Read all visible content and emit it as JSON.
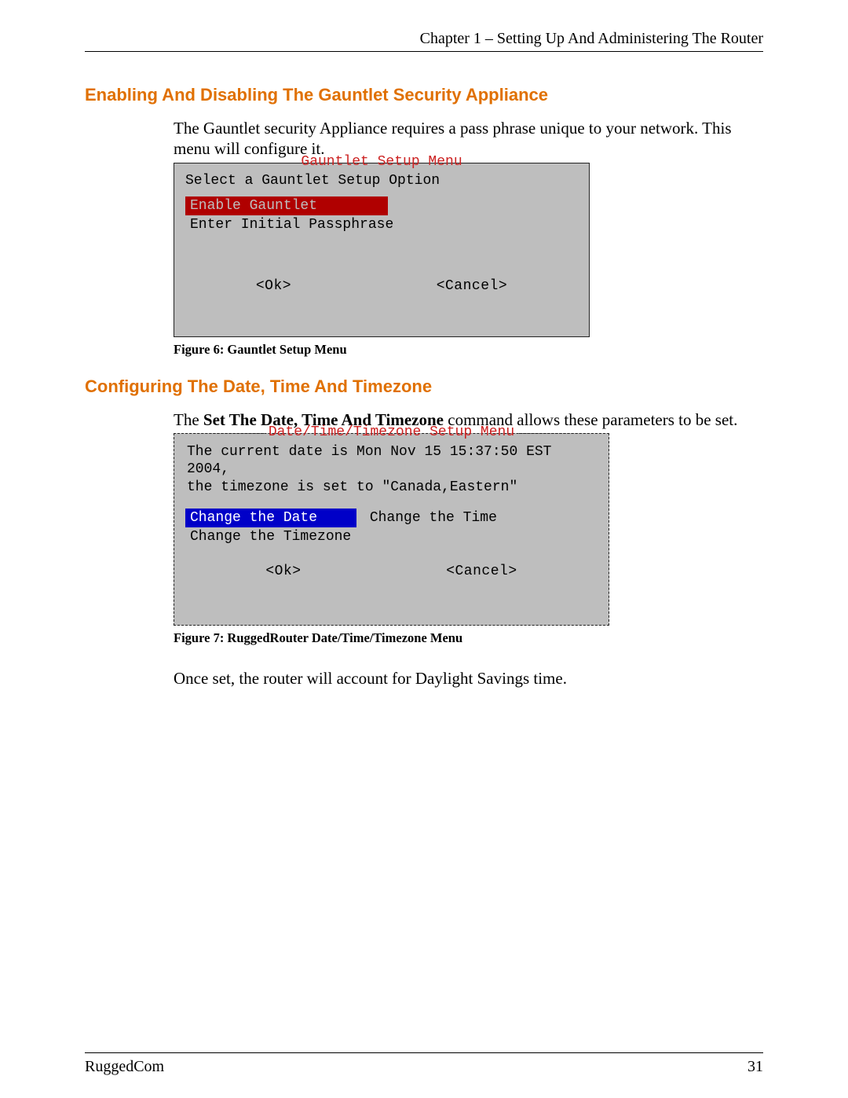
{
  "header": {
    "chapter": "Chapter 1 – Setting Up And Administering The Router"
  },
  "section1": {
    "heading": "Enabling And Disabling The Gauntlet Security Appliance",
    "para": "The Gauntlet security Appliance requires a pass phrase unique to your network.   This menu will configure it.",
    "term": {
      "title": "Gauntlet Setup Menu",
      "prompt": "Select a Gauntlet Setup Option",
      "options": [
        "Enable Gauntlet",
        "Enter Initial Passphrase"
      ],
      "ok": "<Ok>",
      "cancel": "<Cancel>"
    },
    "caption": "Figure 6: Gauntlet Setup Menu"
  },
  "section2": {
    "heading": "Configuring The Date, Time And Timezone",
    "para_pre": "The ",
    "para_bold": "Set The Date, Time And Timezone",
    "para_post": " command allows these parameters to be set.",
    "term": {
      "title": "Date/Time/Timezone Setup Menu",
      "info1": "The current date is Mon Nov 15 15:37:50 EST 2004,",
      "info2": "the timezone is set to \"Canada,Eastern\"",
      "options": [
        "Change the Date",
        "Change the Time",
        "Change the Timezone"
      ],
      "ok": "<Ok>",
      "cancel": "<Cancel>"
    },
    "caption": "Figure 7: RuggedRouter Date/Time/Timezone Menu",
    "note": "Once set, the router will account for Daylight Savings time."
  },
  "footer": {
    "left": "RuggedCom",
    "right": "31"
  }
}
